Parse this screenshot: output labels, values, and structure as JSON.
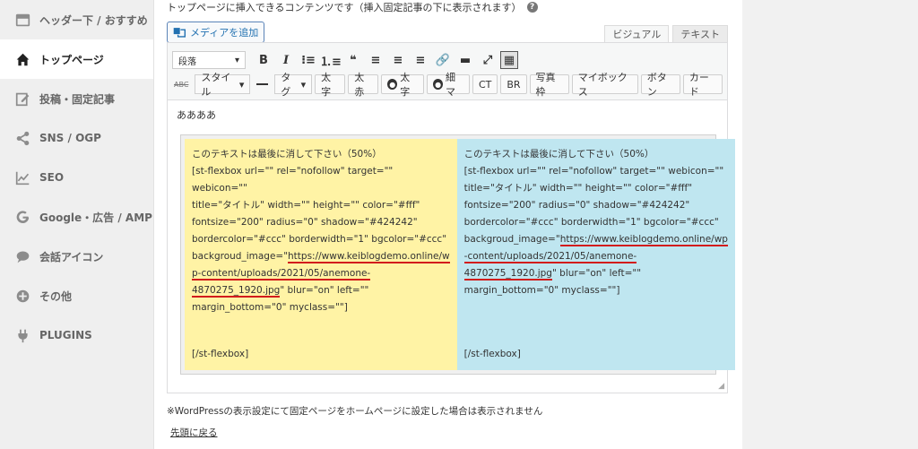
{
  "sidebar": {
    "items": [
      {
        "label": "ヘッダー下 / おすすめ",
        "icon": "header-icon"
      },
      {
        "label": "トップページ",
        "icon": "home-icon"
      },
      {
        "label": "投稿・固定記事",
        "icon": "edit-icon"
      },
      {
        "label": "SNS / OGP",
        "icon": "share-icon"
      },
      {
        "label": "SEO",
        "icon": "chart-icon"
      },
      {
        "label": "Google・広告 / AMP",
        "icon": "google-icon"
      },
      {
        "label": "会話アイコン",
        "icon": "chat-icon"
      },
      {
        "label": "その他",
        "icon": "plus-circle-icon"
      },
      {
        "label": "PLUGINS",
        "icon": "plug-icon"
      }
    ]
  },
  "main": {
    "description": "トップページに挿入できるコンテンツです（挿入固定記事の下に表示されます）",
    "help": "?",
    "media_button": "メディアを追加",
    "tabs": {
      "visual": "ビジュアル",
      "text": "テキスト"
    },
    "toolbar": {
      "format_select": "段落",
      "row2": {
        "style": "スタイル",
        "tag": "タグ",
        "bold_jp": "太字",
        "red": "太赤",
        "bold_circle": "太字",
        "thin": "細マ",
        "ct": "CT",
        "br": "BR",
        "photo": "写真枠",
        "mybox": "マイボックス",
        "button": "ボタン",
        "card": "カード"
      }
    },
    "editor": {
      "first_line": "ああああ",
      "left_col": {
        "line1": "このテキストは最後に消して下さい（50%）",
        "line2": "[st-flexbox url=\"\" rel=\"nofollow\" target=\"\" webicon=\"\"",
        "line3": "title=\"タイトル\" width=\"\" height=\"\" color=\"#fff\"",
        "line4": "fontsize=\"200\" radius=\"0\" shadow=\"#424242\"",
        "line5": "bordercolor=\"#ccc\" borderwidth=\"1\" bgcolor=\"#ccc\"",
        "line6a": "backgroud_image=\"",
        "line6b": "https://www.keiblogdemo.online/w",
        "line7": "p-content/uploads/2021/05/anemone-",
        "line8a": "4870275_1920.jpg",
        "line8b": "\" blur=\"on\" left=\"\"",
        "line9": "margin_bottom=\"0\" myclass=\"\"]",
        "closing": "[/st-flexbox]"
      },
      "right_col": {
        "line1": "このテキストは最後に消して下さい（50%）",
        "line2": "[st-flexbox url=\"\" rel=\"nofollow\" target=\"\" webicon=\"\"",
        "line3": "title=\"タイトル\" width=\"\" height=\"\" color=\"#fff\"",
        "line4": "fontsize=\"200\" radius=\"0\" shadow=\"#424242\"",
        "line5": "bordercolor=\"#ccc\" borderwidth=\"1\" bgcolor=\"#ccc\"",
        "line6a": "backgroud_image=\"",
        "line6b": "https://www.keiblogdemo.online/wp",
        "line7": "-content/uploads/2021/05/anemone-",
        "line8a": "4870275_1920.jpg",
        "line8b": "\" blur=\"on\" left=\"\"",
        "line9": "margin_bottom=\"0\" myclass=\"\"]",
        "closing": "[/st-flexbox]"
      }
    },
    "note": "※WordPressの表示設定にて固定ページをホームページに設定した場合は表示されません",
    "back_link": "先頭に戻る"
  }
}
